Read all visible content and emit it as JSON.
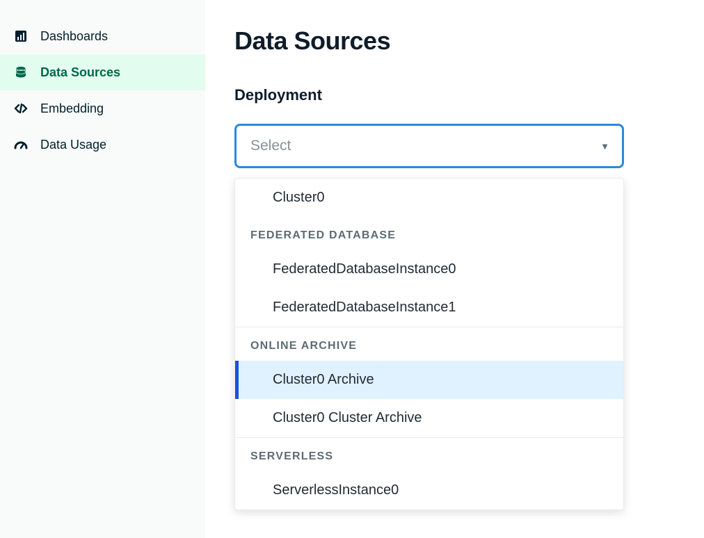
{
  "sidebar": {
    "items": [
      {
        "label": "Dashboards",
        "active": false
      },
      {
        "label": "Data Sources",
        "active": true
      },
      {
        "label": "Embedding",
        "active": false
      },
      {
        "label": "Data Usage",
        "active": false
      }
    ]
  },
  "main": {
    "title": "Data Sources",
    "section_label": "Deployment",
    "select": {
      "placeholder": "Select"
    },
    "dropdown": {
      "groups": [
        {
          "header": null,
          "options": [
            {
              "label": "Cluster0",
              "highlighted": false
            }
          ]
        },
        {
          "header": "Federated Database",
          "options": [
            {
              "label": "FederatedDatabaseInstance0",
              "highlighted": false
            },
            {
              "label": "FederatedDatabaseInstance1",
              "highlighted": false
            }
          ]
        },
        {
          "header": "Online Archive",
          "options": [
            {
              "label": "Cluster0 Archive",
              "highlighted": true
            },
            {
              "label": "Cluster0 Cluster Archive",
              "highlighted": false
            }
          ]
        },
        {
          "header": "Serverless",
          "options": [
            {
              "label": "ServerlessInstance0",
              "highlighted": false
            }
          ]
        }
      ]
    }
  }
}
